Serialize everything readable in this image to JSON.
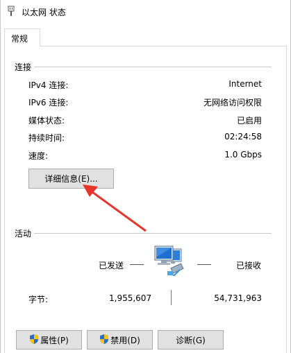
{
  "window": {
    "title": "以太网 状态"
  },
  "tabs": [
    {
      "label": "常规"
    }
  ],
  "connection": {
    "group_title": "连接",
    "rows": [
      {
        "label": "IPv4 连接:",
        "value": "Internet"
      },
      {
        "label": "IPv6 连接:",
        "value": "无网络访问权限"
      },
      {
        "label": "媒体状态:",
        "value": "已启用"
      },
      {
        "label": "持续时间:",
        "value": "02:24:58"
      },
      {
        "label": "速度:",
        "value": "1.0 Gbps"
      }
    ],
    "details_button": "详细信息(E)..."
  },
  "activity": {
    "group_title": "活动",
    "sent_label": "已发送",
    "received_label": "已接收",
    "bytes_label": "字节:",
    "bytes_sent": "1,955,607",
    "bytes_received": "54,731,963"
  },
  "buttons": {
    "properties": "属性(P)",
    "disable": "禁用(D)",
    "diagnose": "诊断(G)"
  },
  "colors": {
    "arrow": "#e8352c",
    "button_bg": "#e1e1e1",
    "button_border": "#adadad",
    "shield_blue": "#2b6cc4",
    "shield_yellow": "#f3c21b"
  },
  "icons": {
    "title": "network-adapter-icon",
    "activity": "network-computers-icon"
  }
}
